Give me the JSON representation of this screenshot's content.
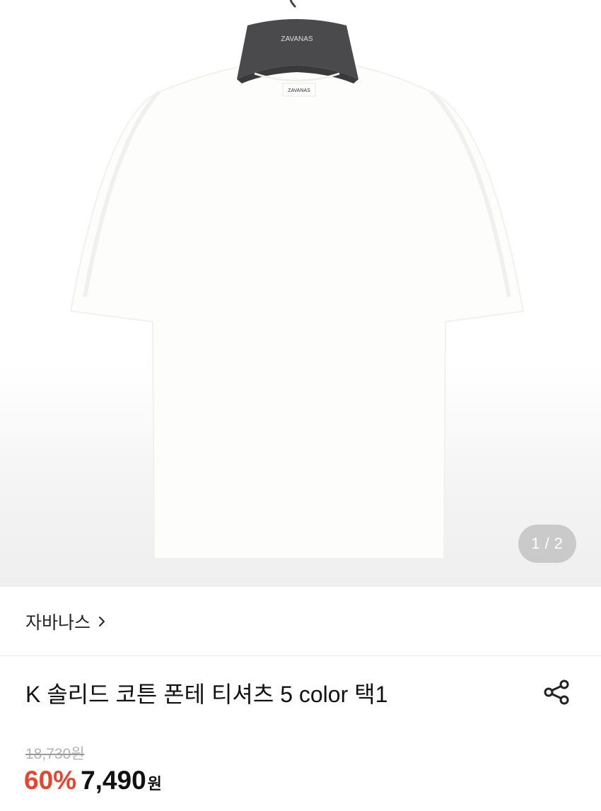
{
  "gallery": {
    "hanger_logo": "ZAVANAS",
    "neck_label": "ZAVANAS",
    "current_page": "1",
    "separator": "/",
    "total_pages": "2"
  },
  "brand": {
    "name": "자바나스",
    "chevron_icon": "chevron-right-icon"
  },
  "product": {
    "title": "K 솔리드 코튼 폰테 티셔츠 5 color 택1",
    "share_icon": "share-icon"
  },
  "price": {
    "original": "18,730원",
    "discount": "60%",
    "sale": "7,490",
    "currency": "원",
    "discount_color": "#e8452f"
  }
}
